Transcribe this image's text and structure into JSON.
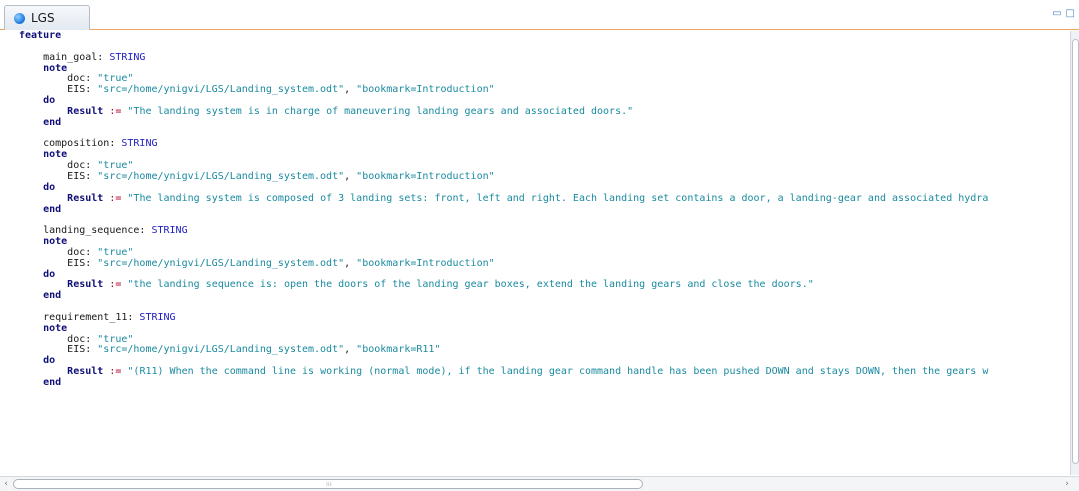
{
  "tab": {
    "title": "LGS"
  },
  "editor": {
    "top_keyword": "feature",
    "note_keyword": "note",
    "do_keyword": "do",
    "end_keyword": "end",
    "doc_label": "doc: ",
    "eis_label": "EIS: ",
    "result_keyword": "Result",
    "assign_op": ":=",
    "features": [
      {
        "name": "main_goal: ",
        "type": "STRING",
        "doc": "\"true\"",
        "eis_src": "\"src=/home/ynigvi/LGS/Landing_system.odt\"",
        "eis_bookmark": "\"bookmark=Introduction\"",
        "result": "\"The landing system is in charge of maneuvering landing gears and associated doors.\""
      },
      {
        "name": "composition: ",
        "type": "STRING",
        "doc": "\"true\"",
        "eis_src": "\"src=/home/ynigvi/LGS/Landing_system.odt\"",
        "eis_bookmark": "\"bookmark=Introduction\"",
        "result": "\"The landing system is composed of 3 landing sets: front, left and right. Each landing set contains a door, a landing-gear and associated hydra"
      },
      {
        "name": "landing_sequence: ",
        "type": "STRING",
        "doc": "\"true\"",
        "eis_src": "\"src=/home/ynigvi/LGS/Landing_system.odt\"",
        "eis_bookmark": "\"bookmark=Introduction\"",
        "result": "\"the landing sequence is: open the doors of the landing gear boxes, extend the landing gears and close the doors.\""
      },
      {
        "name": "requirement_11: ",
        "type": "STRING",
        "doc": "\"true\"",
        "eis_src": "\"src=/home/ynigvi/LGS/Landing_system.odt\"",
        "eis_bookmark": "\"bookmark=R11\"",
        "result": "\"(R11) When the command line is working (normal mode), if the landing gear command handle has been pushed DOWN and stays DOWN, then the gears w"
      }
    ]
  }
}
